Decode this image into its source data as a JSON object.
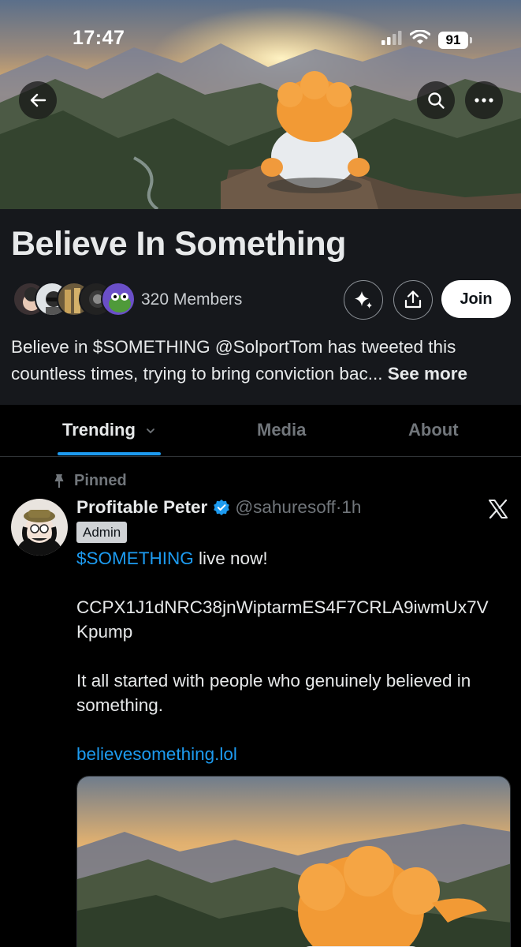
{
  "status_bar": {
    "time": "17:47",
    "battery": "91"
  },
  "community": {
    "title": "Believe In Something",
    "members": "320 Members",
    "join_label": "Join",
    "description_prefix": "Believe in $SOMETHING @SolportTom has tweeted this countless times, trying to bring conviction bac...",
    "see_more": "See more"
  },
  "tabs": [
    {
      "label": "Trending",
      "active": true
    },
    {
      "label": "Media",
      "active": false
    },
    {
      "label": "About",
      "active": false
    }
  ],
  "post": {
    "pinned_label": "Pinned",
    "author_name": "Profitable Peter",
    "handle": "@sahuresoff",
    "separator": "·",
    "age": "1h",
    "badge": "Admin",
    "cashtag": "$SOMETHING",
    "line1_rest": " live now!",
    "contract": "CCPX1J1dNRC38jnWiptarmES4F7CRLA9iwmUx7V",
    "contract_tail": "Kpump",
    "body": "It all started with people who genuinely believed in something.",
    "link": "believesomething.lol"
  },
  "colors": {
    "accent": "#1d9bf0",
    "header_bg": "#16181c",
    "background": "#000000",
    "muted": "#71767b"
  },
  "icons": [
    "back-arrow-icon",
    "search-icon",
    "more-icon",
    "sparkle-icon",
    "share-icon",
    "pin-icon",
    "verified-icon",
    "x-logo-icon",
    "chevron-down-icon",
    "signal-icon",
    "wifi-icon",
    "battery-icon"
  ]
}
